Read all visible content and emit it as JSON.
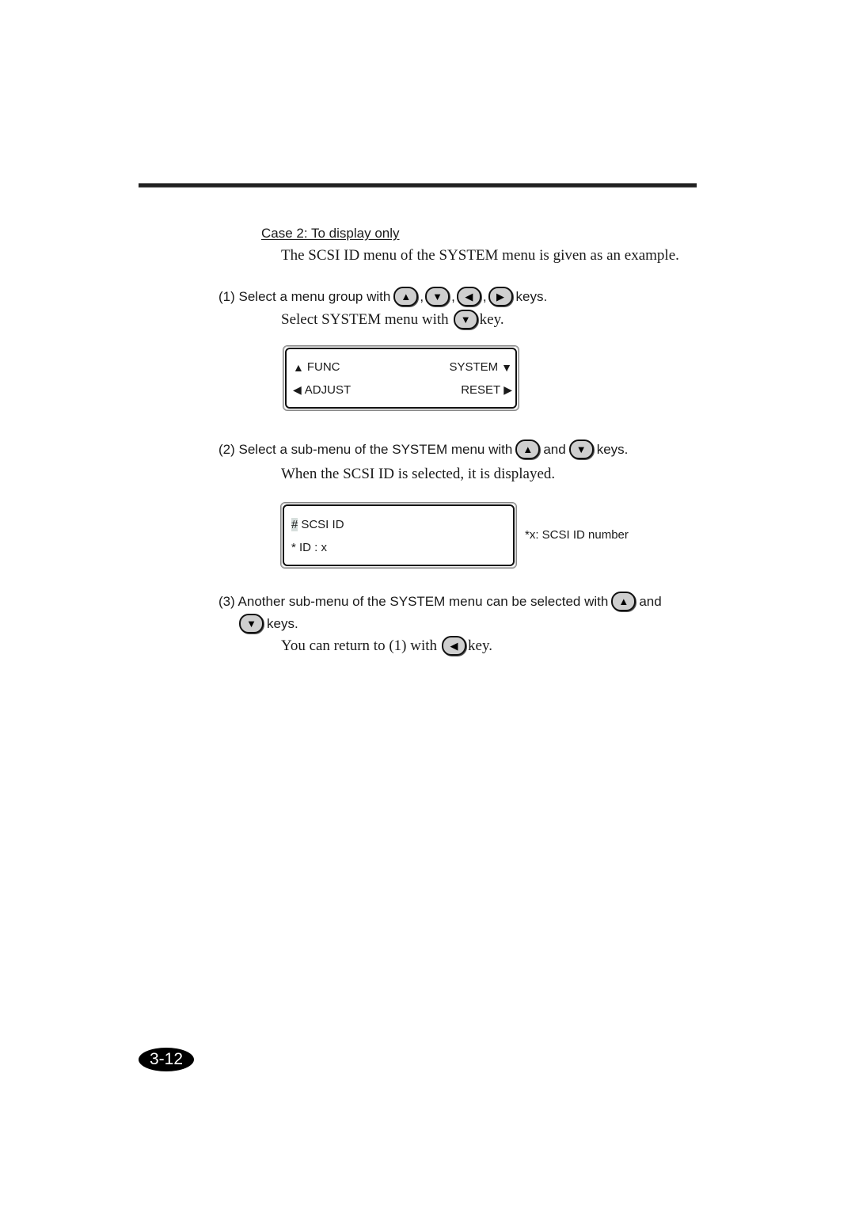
{
  "section": {
    "heading": "Case 2: To display only",
    "intro": "The SCSI ID menu of the SYSTEM menu is given as an example."
  },
  "step1": {
    "prefix": "(1) Select a menu group with",
    "keys": [
      "up",
      "down",
      "left",
      "right"
    ],
    "separator": ",",
    "suffix": "keys.",
    "sub_prefix": "Select SYSTEM menu with",
    "sub_key": "down",
    "sub_suffix": "key."
  },
  "lcd1": {
    "top_left": "FUNC",
    "top_right": "SYSTEM",
    "bottom_left": "ADJUST",
    "bottom_right": "RESET"
  },
  "step2": {
    "prefix": "(2) Select a sub-menu of the SYSTEM menu with",
    "conj": "and",
    "suffix": "keys.",
    "sub": "When the SCSI ID is selected, it is displayed."
  },
  "lcd2": {
    "cursor": "#",
    "line1": "SCSI ID",
    "line2": "* ID : x",
    "note": "*x: SCSI ID number"
  },
  "step3": {
    "prefix": "(3) Another sub-menu of the SYSTEM menu can be selected with",
    "conj": "and",
    "suffix": "keys.",
    "sub_prefix": "You can return to (1) with",
    "sub_suffix": "key."
  },
  "glyphs": {
    "up": "▲",
    "down": "▼",
    "left": "◀",
    "right": "▶"
  },
  "page_number": "3-12"
}
